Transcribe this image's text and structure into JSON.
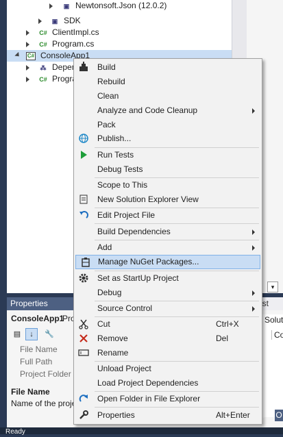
{
  "solution_explorer": {
    "tree": [
      {
        "label": "Newtonsoft.Json (12.0.2)",
        "icon": "package-icon"
      },
      {
        "label": "SDK",
        "icon": "package-icon"
      },
      {
        "label": "ClientImpl.cs",
        "icon": "csharp-file-icon",
        "icon_text": "C#"
      },
      {
        "label": "Program.cs",
        "icon": "csharp-file-icon",
        "icon_text": "C#"
      },
      {
        "label": "ConsoleApp1",
        "icon": "project-icon",
        "icon_text": "C#",
        "selected": true
      },
      {
        "label": "Depen",
        "icon": "dependencies-icon"
      },
      {
        "label": "Progra",
        "icon": "csharp-file-icon",
        "icon_text": "C#"
      }
    ]
  },
  "properties": {
    "title": "Properties",
    "object": "ConsoleApp1",
    "object_type": "Proj",
    "rows": [
      "File Name",
      "Full Path",
      "Project Folder"
    ],
    "desc_title": "File Name",
    "desc_text": "Name of the proje"
  },
  "right_panel": {
    "tab_fragment": "est",
    "solutions_fragment": "Soluti",
    "cell_fragment": "Co",
    "bottom_tab_fragment": "ist",
    "bottom_tab_o": "O"
  },
  "status_bar": {
    "text": "Ready"
  },
  "context_menu": {
    "items": [
      {
        "label": "Build",
        "icon": "build-icon"
      },
      {
        "label": "Rebuild"
      },
      {
        "label": "Clean"
      },
      {
        "label": "Analyze and Code Cleanup",
        "submenu": true
      },
      {
        "label": "Pack"
      },
      {
        "label": "Publish...",
        "icon": "globe-icon"
      },
      {
        "label": "Run Tests",
        "icon": "run-icon"
      },
      {
        "label": "Debug Tests"
      },
      {
        "label": "Scope to This"
      },
      {
        "label": "New Solution Explorer View",
        "icon": "new-view-icon"
      },
      {
        "label": "Edit Project File",
        "icon": "undo-arrow-icon"
      },
      {
        "label": "Build Dependencies",
        "submenu": true
      },
      {
        "label": "Add",
        "submenu": true
      },
      {
        "label": "Manage NuGet Packages...",
        "icon": "nuget-icon",
        "highlighted": true
      },
      {
        "label": "Set as StartUp Project",
        "icon": "gear-icon"
      },
      {
        "label": "Debug",
        "submenu": true
      },
      {
        "label": "Source Control",
        "submenu": true
      },
      {
        "label": "Cut",
        "icon": "scissors-icon",
        "shortcut": "Ctrl+X"
      },
      {
        "label": "Remove",
        "icon": "remove-icon",
        "shortcut": "Del"
      },
      {
        "label": "Rename",
        "icon": "rename-icon"
      },
      {
        "label": "Unload Project"
      },
      {
        "label": "Load Project Dependencies"
      },
      {
        "label": "Open Folder in File Explorer",
        "icon": "refresh-arrow-icon"
      },
      {
        "label": "Properties",
        "icon": "wrench-icon",
        "shortcut": "Alt+Enter"
      }
    ],
    "colors": {
      "highlight": "#c9ddf4",
      "highlight_border": "#7fb0e6",
      "run": "#1e9e3a",
      "remove": "#c42b1c",
      "globe": "#1e88c8"
    }
  }
}
